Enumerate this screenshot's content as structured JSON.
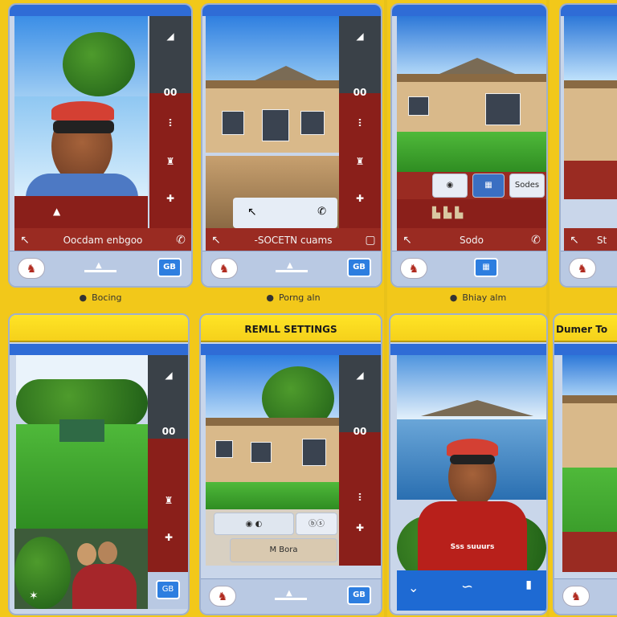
{
  "top_row": [
    {
      "side_buttons": [
        "◢",
        "00",
        "ⵗ",
        "♜",
        "✚"
      ],
      "footer_label": "Oocdam enbgoo",
      "caption": "Bocing"
    },
    {
      "side_buttons": [
        "◢",
        "00",
        "ⵗ",
        "♜",
        "✚"
      ],
      "footer_label": "-SOCETN cuams",
      "caption": "Porng aln"
    },
    {
      "strip_label": "Sodes",
      "footer_label": "Sodo",
      "caption": "Bhiay alm"
    },
    {
      "footer_label": "St"
    }
  ],
  "bottom_row": [
    {
      "header": "",
      "side_buttons": [
        "◢",
        "00",
        "♜",
        "✚"
      ]
    },
    {
      "header": "REMLL SETTINGS",
      "side_buttons": [
        "◢",
        "00",
        "ⵗ",
        "✚"
      ],
      "strip_label": "M Bora"
    },
    {
      "header": "",
      "shirt_text": "Sss suuurs"
    },
    {
      "header": "Dumer To"
    }
  ],
  "dock": {
    "left_icon": "♞",
    "right_icon": "GB"
  }
}
